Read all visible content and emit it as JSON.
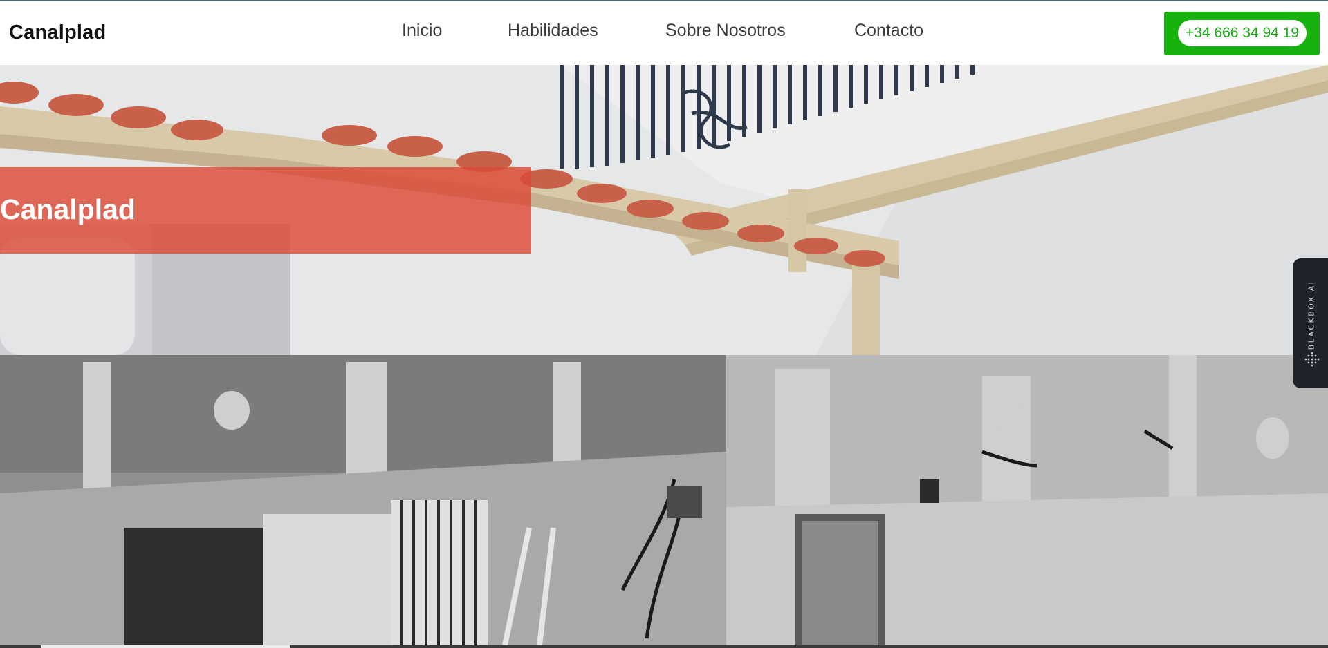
{
  "header": {
    "brand": "Canalplad",
    "nav": [
      {
        "label": "Inicio"
      },
      {
        "label": "Habilidades"
      },
      {
        "label": "Sobre Nosotros"
      },
      {
        "label": "Contacto"
      }
    ],
    "phone_button": {
      "label": "+34 666 34 94 19"
    }
  },
  "hero": {
    "title": "Canalplad",
    "banner_color": "#dc4a38"
  },
  "side_tab": {
    "label": "BLACKBOX AI",
    "icon": "dots-logo-icon"
  },
  "colors": {
    "accent_green": "#17b20e",
    "top_line": "#3f6f86",
    "side_tab_bg": "#1f2229"
  }
}
